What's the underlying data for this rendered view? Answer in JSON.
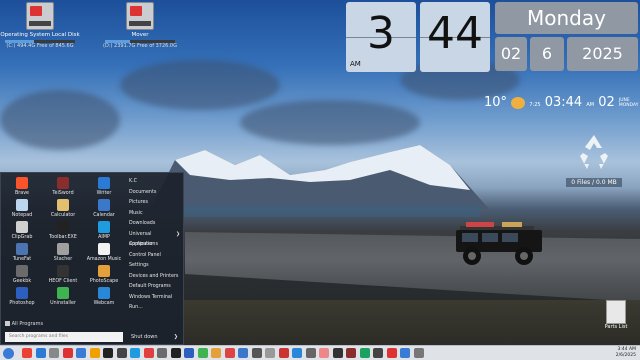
{
  "desktop": {
    "drives": [
      {
        "name": "Operating System Local Disk",
        "free_text": "(C:) 494.4G Free of 845.6G",
        "fill": 0.42
      },
      {
        "name": "Mover",
        "free_text": "(D:) 2391.7G Free of 3726.0G",
        "fill": 0.36
      }
    ],
    "recycle_bin": {
      "label": "0 Files / 0.0 MB"
    },
    "parts_list": {
      "label": "Parts List"
    }
  },
  "clock": {
    "hour": "3",
    "minute": "44",
    "ampm": "AM",
    "weekday": "Monday",
    "month": "02",
    "day": "6",
    "year": "2025"
  },
  "weather": {
    "temp": "10°",
    "small_time_prefix": "7:25",
    "time": "03:44",
    "ampm": "AM",
    "day": "02",
    "month_label": "JUNE",
    "weekday_label": "MONDAY"
  },
  "start_menu": {
    "apps": [
      {
        "label": "Brave",
        "color": "#fb542b"
      },
      {
        "label": "TeiSword",
        "color": "#8a2d2d"
      },
      {
        "label": "Writer",
        "color": "#2b7bd6"
      },
      {
        "label": "Notepad",
        "color": "#bcd6ef"
      },
      {
        "label": "Calculator",
        "color": "#e2c06e"
      },
      {
        "label": "Calendar",
        "color": "#3b78c9"
      },
      {
        "label": "ClipGrab",
        "color": "#d0d0d0"
      },
      {
        "label": "Toolbar.EXE",
        "color": "#222222"
      },
      {
        "label": "AIMP",
        "color": "#1f9be0"
      },
      {
        "label": "TuneFat",
        "color": "#4c74b0"
      },
      {
        "label": "Stacher",
        "color": "#a0a0a0"
      },
      {
        "label": "Amazon Music",
        "color": "#f2f2f2"
      },
      {
        "label": "Geekbk",
        "color": "#6b6b6b"
      },
      {
        "label": "HEOF Client",
        "color": "#333333"
      },
      {
        "label": "PhotoScape",
        "color": "#e4a03a"
      },
      {
        "label": "Photoshop",
        "color": "#2c5fbf"
      },
      {
        "label": "Uninstaller",
        "color": "#3fb34f"
      },
      {
        "label": "Webcam",
        "color": "#2a87d8"
      }
    ],
    "right_items": [
      {
        "label": "K.C",
        "arrow": ""
      },
      {
        "label": "Documents",
        "arrow": ""
      },
      {
        "label": "Pictures",
        "arrow": ""
      },
      {
        "label": "Music",
        "arrow": ""
      },
      {
        "label": "Downloads",
        "arrow": ""
      },
      {
        "label": "Universal applications",
        "arrow": "❯"
      },
      {
        "label": "Computer",
        "arrow": ""
      },
      {
        "label": "Control Panel",
        "arrow": ""
      },
      {
        "label": "Settings",
        "arrow": ""
      },
      {
        "label": "Devices and Printers",
        "arrow": ""
      },
      {
        "label": "Default Programs",
        "arrow": ""
      },
      {
        "label": "Windows Terminal",
        "arrow": ""
      },
      {
        "label": "Run...",
        "arrow": ""
      }
    ],
    "all_programs": "All Programs",
    "search_placeholder": "Search programs and files",
    "shutdown": "Shut down",
    "shutdown_arrow": "❯"
  },
  "taskbar": {
    "icon_colors": [
      "#ea4335",
      "#2b7bd6",
      "#888888",
      "#d33",
      "#3a7bd5",
      "#f2a000",
      "#222",
      "#444",
      "#1f9be0",
      "#e04040",
      "#6b6b6b",
      "#222",
      "#2c5fbf",
      "#3fb34f",
      "#e4a03a",
      "#d44",
      "#3b78c9",
      "#555",
      "#999",
      "#c33",
      "#2a87d8",
      "#666",
      "#e88",
      "#333",
      "#8a2d2d",
      "#1aa260",
      "#444",
      "#d33",
      "#3a7bd5",
      "#777"
    ],
    "tray_time": "3:44 AM",
    "tray_date": "2/6/2025"
  }
}
